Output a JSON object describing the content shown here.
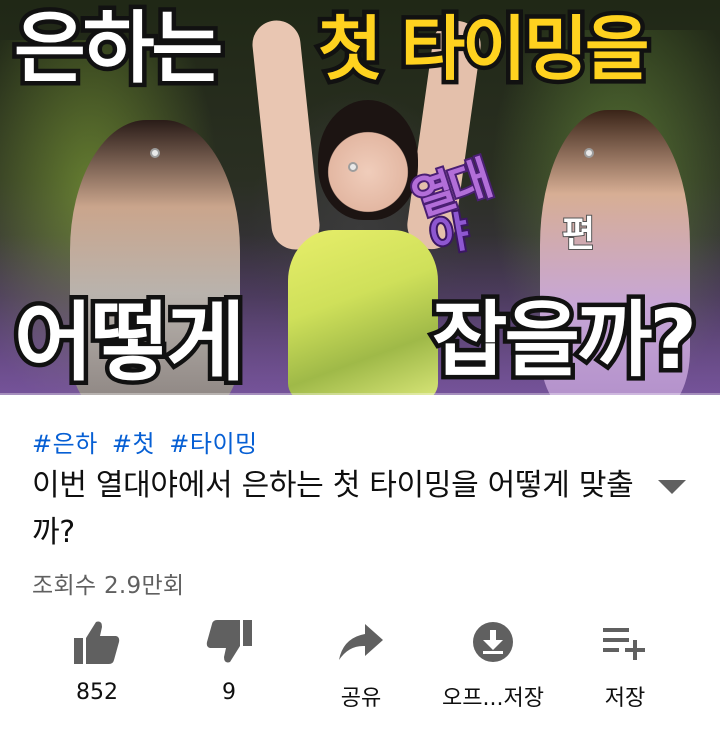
{
  "thumbnail": {
    "caption_line1_white": "은하는",
    "caption_line1_yellow": "첫 타이밍을",
    "caption_line2_left": "어떻게",
    "caption_line2_right": "잡을까?",
    "show_logo_top": "열대",
    "show_logo_bottom": "야",
    "show_logo_suffix": "편",
    "progress": 0.0
  },
  "video": {
    "hashtags": [
      "#은하",
      "#첫",
      "#타이밍"
    ],
    "title": "이번 열대야에서 은하는 첫 타이밍을 어떻게 맞출까?",
    "views": "조회수 2.9만회"
  },
  "actions": [
    {
      "icon": "thumbs-up-icon",
      "label": "852"
    },
    {
      "icon": "thumbs-down-icon",
      "label": "9"
    },
    {
      "icon": "share-icon",
      "label": "공유"
    },
    {
      "icon": "download-icon",
      "label": "오프...저장"
    },
    {
      "icon": "add-to-playlist-icon",
      "label": "저장"
    }
  ],
  "colors": {
    "hashtag": "#065fd4",
    "icon": "#606060",
    "caption_yellow": "#ffd21f"
  }
}
